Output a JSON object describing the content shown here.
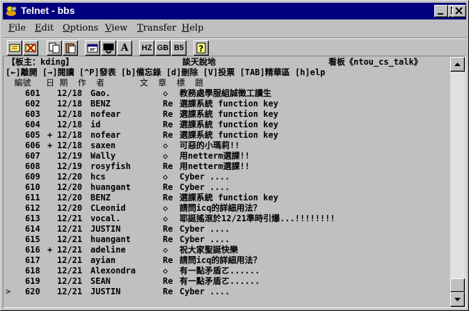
{
  "window": {
    "title": "Telnet - bbs"
  },
  "menu": [
    "File",
    "Edit",
    "Options",
    "View",
    "Transfer",
    "Help"
  ],
  "menu_accel": [
    "F",
    "E",
    "O",
    "V",
    "T",
    "H"
  ],
  "toolbar": {
    "encodings": [
      "HZ",
      "GB",
      "B5"
    ],
    "font_label": "A",
    "help_label": "?"
  },
  "terminal": {
    "header": {
      "moderator": "【板主：kding】",
      "title": "談天說地",
      "board": "看板《ntou_cs_talk》"
    },
    "helpbar": "[←]離開 [→]閱讀 [^P]發表 [b]備忘錄 [d]刪除 [V]投票 [TAB]精華區 [h]elp",
    "columns": "  編號   日 期  作  者       文  章  標  題",
    "cursor": ">",
    "posts": [
      {
        "num": "601",
        "mark": " ",
        "date": "12/18",
        "author": "Gao.",
        "type": "◇",
        "title": "教務處學服組誠徵工讀生"
      },
      {
        "num": "602",
        "mark": " ",
        "date": "12/18",
        "author": "BENZ",
        "type": "Re",
        "title": "選課系統 function key"
      },
      {
        "num": "603",
        "mark": " ",
        "date": "12/18",
        "author": "nofear",
        "type": "Re",
        "title": "選課系統 function key"
      },
      {
        "num": "604",
        "mark": " ",
        "date": "12/18",
        "author": "id",
        "type": "Re",
        "title": "選課系統 function key"
      },
      {
        "num": "605",
        "mark": "+",
        "date": "12/18",
        "author": "nofear",
        "type": "Re",
        "title": "選課系統 function key"
      },
      {
        "num": "606",
        "mark": "+",
        "date": "12/18",
        "author": "saxen",
        "type": "◇",
        "title": "可惡的小瑪莉!!"
      },
      {
        "num": "607",
        "mark": " ",
        "date": "12/19",
        "author": "Wally",
        "type": "◇",
        "title": "用netterm選課!!"
      },
      {
        "num": "608",
        "mark": " ",
        "date": "12/19",
        "author": "rosyfish",
        "type": "Re",
        "title": "用netterm選課!!"
      },
      {
        "num": "609",
        "mark": " ",
        "date": "12/20",
        "author": "hcs",
        "type": "◇",
        "title": "Cyber ...."
      },
      {
        "num": "610",
        "mark": " ",
        "date": "12/20",
        "author": "huangant",
        "type": "Re",
        "title": "Cyber ...."
      },
      {
        "num": "611",
        "mark": " ",
        "date": "12/20",
        "author": "BENZ",
        "type": "Re",
        "title": "選課系統 function key"
      },
      {
        "num": "612",
        "mark": " ",
        "date": "12/20",
        "author": "CLeonid",
        "type": "◇",
        "title": "請問icq的詳細用法？"
      },
      {
        "num": "613",
        "mark": " ",
        "date": "12/21",
        "author": "vocal.",
        "type": "◇",
        "title": "耶誕搖滾於12/21準時引爆...!!!!!!!!"
      },
      {
        "num": "614",
        "mark": " ",
        "date": "12/21",
        "author": "JUSTIN",
        "type": "Re",
        "title": "Cyber ...."
      },
      {
        "num": "615",
        "mark": " ",
        "date": "12/21",
        "author": "huangant",
        "type": "Re",
        "title": "Cyber ...."
      },
      {
        "num": "616",
        "mark": "+",
        "date": "12/21",
        "author": "adeline",
        "type": "◇",
        "title": "祝大家聖誕快樂"
      },
      {
        "num": "617",
        "mark": " ",
        "date": "12/21",
        "author": "ayian",
        "type": "Re",
        "title": "請問icq的詳細用法？"
      },
      {
        "num": "618",
        "mark": " ",
        "date": "12/21",
        "author": "Alexondra",
        "type": "◇",
        "title": "有一點矛盾ㄛ......"
      },
      {
        "num": "619",
        "mark": " ",
        "date": "12/21",
        "author": "SEAN",
        "type": "Re",
        "title": "有一點矛盾ㄛ......"
      },
      {
        "num": "620",
        "mark": " ",
        "date": "12/21",
        "author": "JUSTIN",
        "type": "Re",
        "title": "Cyber ...."
      }
    ]
  },
  "colors": {
    "titlebar": "#000080",
    "chrome": "#c0c0c0",
    "text": "#000000"
  },
  "icons": [
    "telnet-app-icon",
    "minimize-icon",
    "maximize-icon",
    "close-icon",
    "connect-icon",
    "disconnect-icon",
    "copy-icon",
    "paste-icon",
    "properties-icon",
    "terminal-settings-icon",
    "help-icon",
    "scroll-up-icon",
    "scroll-down-icon"
  ]
}
